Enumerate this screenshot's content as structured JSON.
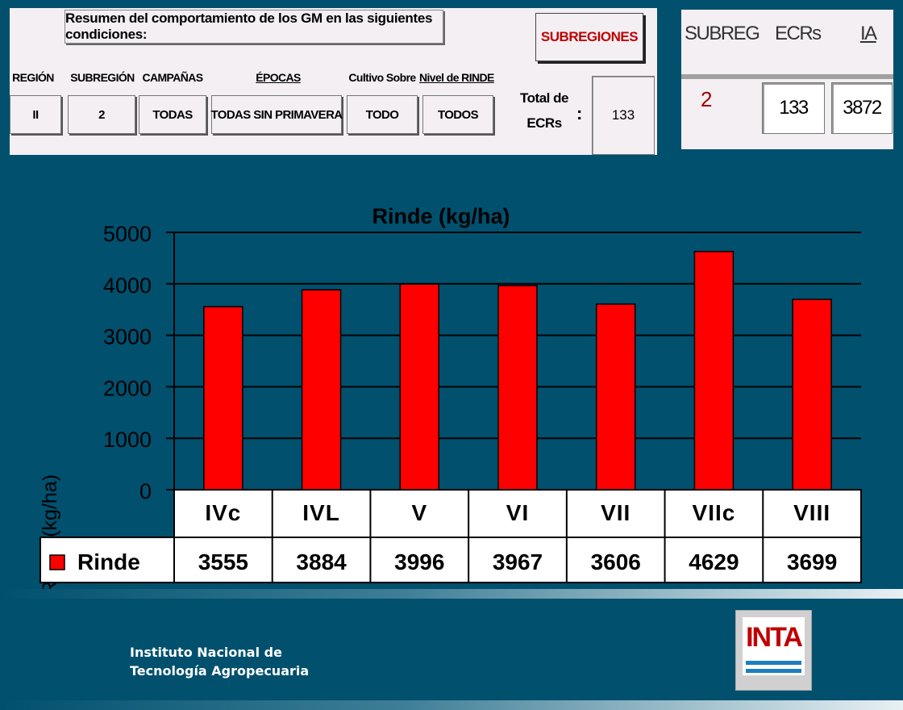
{
  "summary": {
    "title": "Resumen del comportamiento de los GM en las siguientes condiciones:",
    "headers": [
      "REGIÓN",
      "SUBREGIÓN",
      "CAMPAÑAS",
      "ÉPOCAS",
      "Cultivo Sobre",
      "Nivel de RINDE"
    ],
    "values": [
      "II",
      "2",
      "TODAS",
      "TODAS SIN PRIMAVERA",
      "TODO",
      "TODOS"
    ],
    "subregiones_button": "SUBREGIONES",
    "total_label_line1": "Total de",
    "total_label_line2": "ECRs",
    "colon": ":",
    "total_value": "133"
  },
  "subreg_panel": {
    "headers": [
      "SUBREG",
      "ECRs",
      "IA"
    ],
    "values": [
      "2",
      "133",
      "3872"
    ]
  },
  "chart_data": {
    "type": "bar",
    "title": "Rinde (kg/ha)",
    "ylabel": "Rinde (kg/ha)",
    "xlabel": "",
    "categories": [
      "IVc",
      "IVL",
      "V",
      "VI",
      "VII",
      "VIIc",
      "VIII"
    ],
    "series": [
      {
        "name": "Rinde",
        "values": [
          3555,
          3884,
          3996,
          3967,
          3606,
          4629,
          3699
        ]
      }
    ],
    "ylim": [
      0,
      5000
    ],
    "yticks": [
      0,
      1000,
      2000,
      3000,
      4000,
      5000
    ],
    "grid": true,
    "legend": "data-table-left",
    "bar_color": "#ff0000"
  },
  "footer": {
    "institute_line1": "Instituto Nacional de",
    "institute_line2": "Tecnología Agropecuaria",
    "logo_text": "INTA"
  },
  "colors": {
    "background": "#00506e",
    "panel": "#f3eff3",
    "accent_red": "#c00000"
  }
}
